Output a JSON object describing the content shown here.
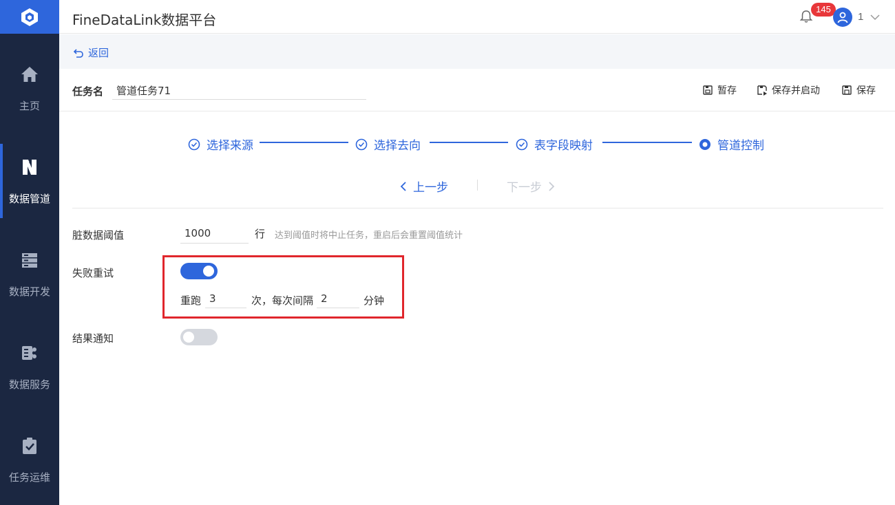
{
  "app": {
    "title": "FineDataLink数据平台"
  },
  "header": {
    "notification_count": "145",
    "user_name": "1"
  },
  "sidebar": {
    "items": [
      {
        "label": "主页",
        "icon": "home-icon"
      },
      {
        "label": "数据管道",
        "icon": "pipeline-icon",
        "active": true
      },
      {
        "label": "数据开发",
        "icon": "server-icon"
      },
      {
        "label": "数据服务",
        "icon": "service-icon"
      },
      {
        "label": "任务运维",
        "icon": "clipboard-check-icon"
      }
    ]
  },
  "nav": {
    "back_label": "返回"
  },
  "task": {
    "name_label": "任务名",
    "name_value": "管道任务71",
    "actions": {
      "draft": "暂存",
      "save_and_start": "保存并启动",
      "save": "保存"
    }
  },
  "steps": [
    {
      "label": "选择来源",
      "status": "done"
    },
    {
      "label": "选择去向",
      "status": "done"
    },
    {
      "label": "表字段映射",
      "status": "done"
    },
    {
      "label": "管道控制",
      "status": "current"
    }
  ],
  "pager": {
    "prev_label": "上一步",
    "next_label": "下一步"
  },
  "form": {
    "dirty_threshold": {
      "label": "脏数据阈值",
      "value": "1000",
      "unit": "行",
      "hint": "达到阈值时将中止任务，重启后会重置阈值统计"
    },
    "retry": {
      "label": "失败重试",
      "enabled": true,
      "prefix": "重跑",
      "times_value": "3",
      "middle": "次，每次间隔",
      "interval_value": "2",
      "suffix": "分钟"
    },
    "notify": {
      "label": "结果通知",
      "enabled": false
    }
  },
  "colors": {
    "accent": "#2e66dc",
    "sidebar_bg": "#1b2741",
    "highlight": "#e0262c",
    "badge": "#e8373a"
  }
}
